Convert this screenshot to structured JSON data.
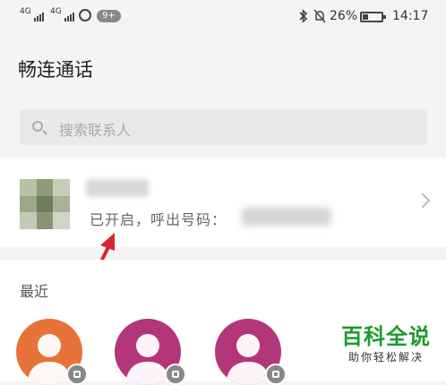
{
  "status_bar": {
    "network_1": "4G",
    "network_2": "4G",
    "notification_badge": "9+",
    "battery_percent": "26%",
    "battery_level": 0.26,
    "time": "14:17"
  },
  "page": {
    "title": "畅连通话"
  },
  "search": {
    "placeholder": "搜索联系人"
  },
  "service_card": {
    "status_text": "已开启，呼出号码："
  },
  "recent": {
    "title": "最近",
    "contacts": [
      {
        "avatar_color": "#e8733a",
        "badge_icon": "phone-icon"
      },
      {
        "avatar_color": "#b3367a",
        "badge_icon": "video-icon"
      },
      {
        "avatar_color": "#b3367a",
        "badge_icon": "phone-icon"
      }
    ]
  },
  "watermark": {
    "main": "百科全说",
    "sub": "助你轻松解决"
  },
  "annotation": {
    "arrow_color": "#d9262c"
  }
}
